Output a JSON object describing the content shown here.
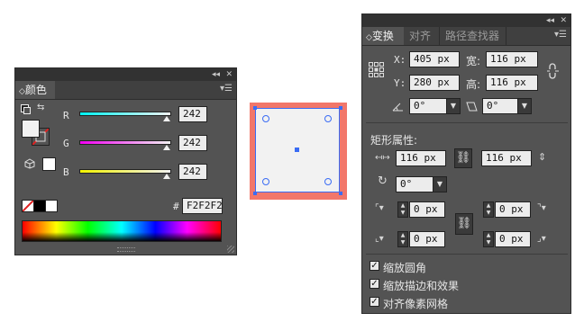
{
  "color_panel": {
    "collapse_glyph": "◂◂",
    "close_glyph": "✕",
    "tab_label": "颜色",
    "tab_prefix": "◇",
    "menu_glyph": "▾☰",
    "channels": [
      {
        "label": "R",
        "value": "242",
        "level": 0.949
      },
      {
        "label": "G",
        "value": "242",
        "level": 0.949
      },
      {
        "label": "B",
        "value": "242",
        "level": 0.949
      }
    ],
    "hex_label": "#",
    "hex_value": "F2F2F2",
    "fill_color": "#F2F2F2",
    "icons": [
      "swap-colors-icon",
      "default-colors-icon",
      "out-of-gamut-cube-icon",
      "none-swatch-icon",
      "black-swatch-icon",
      "white-swatch-icon",
      "resize-grip-icon"
    ]
  },
  "canvas": {
    "selection_color": "#3a6cf4",
    "frame_color": "#f2776a",
    "fill_color": "#F2F2F2"
  },
  "transform_panel": {
    "collapse_glyph": "◂◂",
    "close_glyph": "✕",
    "tabs": [
      {
        "label": "变换",
        "prefix": "◇",
        "active": true
      },
      {
        "label": "对齐",
        "active": false
      },
      {
        "label": "路径查找器",
        "active": false
      }
    ],
    "menu_glyph": "▾☰",
    "x_label": "X:",
    "x_value": "405 px",
    "y_label": "Y:",
    "y_value": "280 px",
    "w_label": "宽:",
    "w_value": "116 px",
    "h_label": "高:",
    "h_value": "116 px",
    "angle_value": "0°",
    "shear_value": "0°",
    "rect_props_title": "矩形属性:",
    "rect_width": "116 px",
    "rect_height": "116 px",
    "corner_rotation": "0°",
    "corner_radii": [
      "0 px",
      "0 px",
      "0 px",
      "0 px"
    ],
    "options": [
      {
        "label": "缩放圆角",
        "checked": true
      },
      {
        "label": "缩放描边和效果",
        "checked": true
      },
      {
        "label": "对齐像素网格",
        "checked": true
      }
    ]
  }
}
